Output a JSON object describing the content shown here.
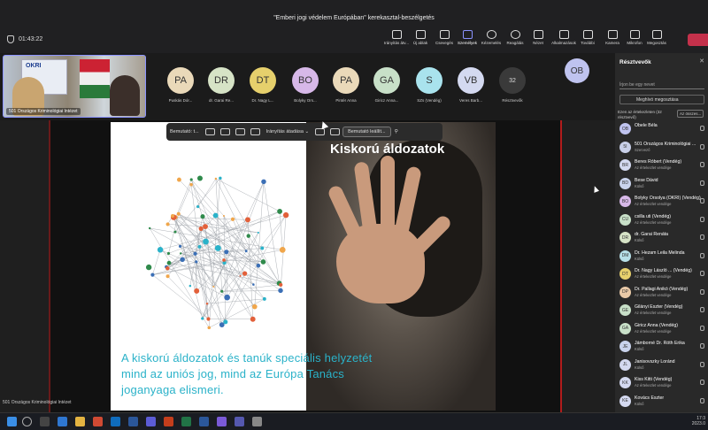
{
  "window": {
    "title": "\"Emberi jogi védelem Európában\" kerekasztal-beszélgetés",
    "timer": "01:43:22"
  },
  "toolbar": [
    {
      "label": "Irányítás átv...",
      "icon": "pointer-icon"
    },
    {
      "label": "Új ablak",
      "icon": "window-icon"
    },
    {
      "label": "Csevegés",
      "icon": "chat-icon"
    },
    {
      "label": "Személyek",
      "icon": "people-icon",
      "active": true
    },
    {
      "label": "Kézemelés",
      "icon": "hand-icon"
    },
    {
      "label": "Reagálás",
      "icon": "smile-icon"
    },
    {
      "label": "Nézet",
      "icon": "grid-icon"
    },
    {
      "label": "Alkalmazások",
      "icon": "apps-icon"
    },
    {
      "label": "További",
      "icon": "more-icon"
    },
    {
      "label": "Kamera",
      "icon": "camera-icon"
    },
    {
      "label": "Mikrofon",
      "icon": "mic-icon"
    },
    {
      "label": "Megosztás",
      "icon": "share-icon"
    }
  ],
  "self_tile": {
    "banner": "OKRI",
    "caption": "501 Országos Kriminológiai Intézet"
  },
  "participants_strip": [
    {
      "initials": "PA",
      "name": "Puskás Dór...",
      "color": "#ead9b9"
    },
    {
      "initials": "DR",
      "name": "dr. Garai Re...",
      "color": "#d6e3c6"
    },
    {
      "initials": "DT",
      "name": "Dr. Nagy L...",
      "color": "#e6d06c"
    },
    {
      "initials": "BO",
      "name": "Bolyky Ors...",
      "color": "#d7b8e8"
    },
    {
      "initials": "PA",
      "name": "Pintér Anna",
      "color": "#ead9b9"
    },
    {
      "initials": "GA",
      "name": "Giricz Anna...",
      "color": "#c8e0c8"
    },
    {
      "initials": "S",
      "name": "SZs (Vendég)",
      "color": "#a9e3ed"
    },
    {
      "initials": "VB",
      "name": "Veres Barb...",
      "color": "#d4d9f0"
    },
    {
      "initials": "32",
      "name": "Résztvevők",
      "color": "#3a3a3a"
    }
  ],
  "ob_avatar": "OB",
  "share_toolbar": {
    "presenter": "Bemutató: t...",
    "control": "Irányítás átadása",
    "stop": "Bemutató leállít..."
  },
  "slide": {
    "title": "Kiskorú áldozatok",
    "text": "A kiskorú áldozatok és tanúk speciális helyzetét mind az uniós jog, mind az Európa Tanács joganyaga elismeri."
  },
  "panel": {
    "title": "Résztvevők",
    "search_placeholder": "Írjon be egy nevet",
    "share_invite": "Meghívó megosztása",
    "section": "Ezen az értekezleten (32 résztvevő)",
    "mute_all": "Az összes...",
    "people": [
      {
        "initials": "OB",
        "name": "Obele Béla",
        "sub": "",
        "color": "#bfc3ef"
      },
      {
        "initials": "5I",
        "name": "501 Országos Kriminológiai ...",
        "sub": "Szervező",
        "color": "#c8cfe8"
      },
      {
        "initials": "BR",
        "name": "Beres Róbert (Vendég)",
        "sub": "Az értekezlet vendége",
        "color": "#d4d9f0"
      },
      {
        "initials": "BD",
        "name": "Bese Dávid",
        "sub": "Külső",
        "color": "#c9d3ec"
      },
      {
        "initials": "BO",
        "name": "Bolyky Orsolya (OKRI) (Vendég)",
        "sub": "Az értekezlet vendége",
        "color": "#d7b8e8"
      },
      {
        "initials": "CU",
        "name": "csilla uti (Vendég)",
        "sub": "Az értekezlet vendége",
        "color": "#c8e0c8"
      },
      {
        "initials": "DR",
        "name": "dr. Garai Renáta",
        "sub": "Külső",
        "color": "#d6e3c6"
      },
      {
        "initials": "DM",
        "name": "Dr. Hezam Leila Melinda",
        "sub": "Külső",
        "color": "#b7e0e8"
      },
      {
        "initials": "DT",
        "name": "Dr. Nagy László ... (Vendég)",
        "sub": "Az értekezlet vendége",
        "color": "#e6d06c"
      },
      {
        "initials": "DP",
        "name": "Dr. Pallagi Anikó (Vendég)",
        "sub": "Az értekezlet vendége",
        "color": "#e9c9a7"
      },
      {
        "initials": "GE",
        "name": "Gilányi Eszter (Vendég)",
        "sub": "Az értekezlet vendége",
        "color": "#c8e0c8"
      },
      {
        "initials": "GA",
        "name": "Giricz Anna (Vendég)",
        "sub": "Az értekezlet vendége",
        "color": "#c8e0c8"
      },
      {
        "initials": "JE",
        "name": "Jámborné Dr. Róth Erika",
        "sub": "Külső",
        "color": "#c9d3ec"
      },
      {
        "initials": "JL",
        "name": "Janisovszky Loránd",
        "sub": "Külső",
        "color": "#d4d9f0"
      },
      {
        "initials": "KK",
        "name": "Kiss Kitti (Vendég)",
        "sub": "Az értekezlet vendége",
        "color": "#d4d9f0"
      },
      {
        "initials": "KE",
        "name": "Kovács Eszter",
        "sub": "Külső",
        "color": "#d4d9f0"
      }
    ]
  },
  "taskbar": {
    "time": "17:3",
    "date": "2023.0"
  }
}
